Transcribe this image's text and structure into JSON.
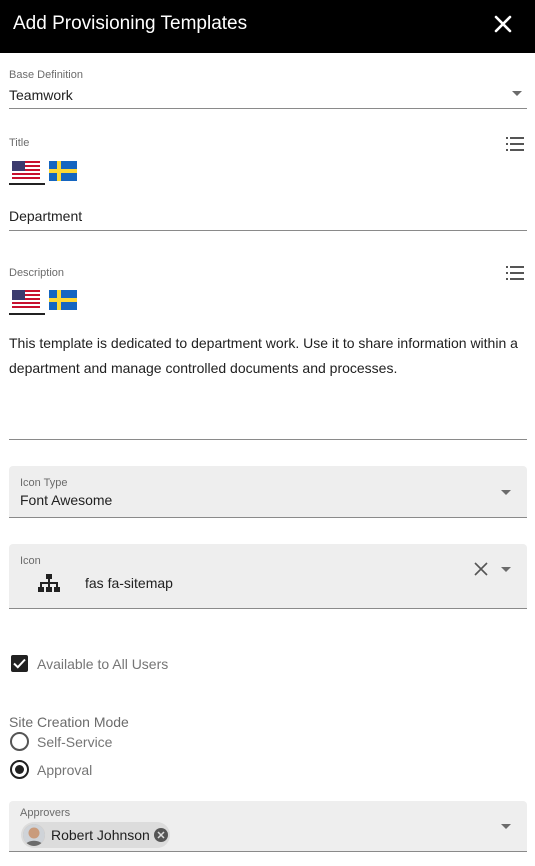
{
  "header": {
    "title": "Add Provisioning Templates",
    "close_icon": "close-icon"
  },
  "base_definition": {
    "label": "Base Definition",
    "value": "Teamwork"
  },
  "title_field": {
    "label": "Title",
    "value": "Department",
    "languages": [
      "en-US",
      "sv-SE"
    ]
  },
  "description_field": {
    "label": "Description",
    "value": "This template is dedicated to department work. Use it to share information within a department and manage controlled documents and processes.",
    "languages": [
      "en-US",
      "sv-SE"
    ]
  },
  "icon_type": {
    "label": "Icon Type",
    "value": "Font Awesome"
  },
  "icon": {
    "label": "Icon",
    "value": "fas fa-sitemap",
    "icon_name": "sitemap-icon"
  },
  "available_all_users": {
    "label": "Available to All Users",
    "checked": true
  },
  "site_creation_mode": {
    "label": "Site Creation Mode",
    "options": [
      "Self-Service",
      "Approval"
    ],
    "selected": "Approval"
  },
  "approvers": {
    "label": "Approvers",
    "users": [
      "Robert Johnson"
    ]
  },
  "colors": {
    "header_bg": "#000000",
    "filled_bg": "#eeeeee"
  }
}
